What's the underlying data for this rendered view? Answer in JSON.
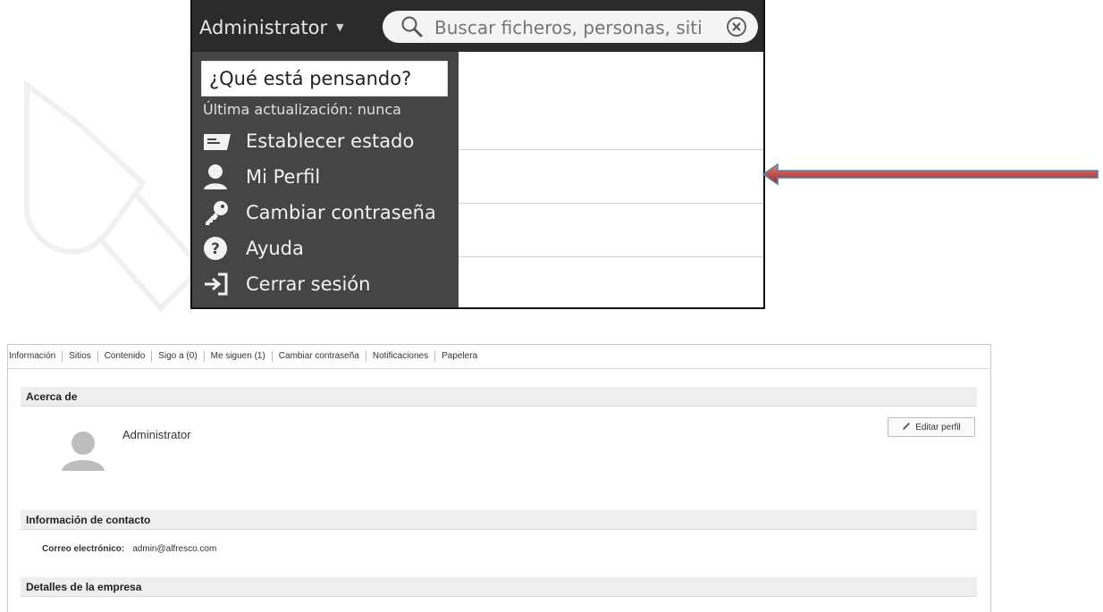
{
  "menu_screenshot": {
    "user_name": "Administrator",
    "search_placeholder": "Buscar ficheros, personas, siti",
    "status_input_value": "¿Qué está pensando?",
    "last_update": "Última actualización: nunca",
    "items": [
      {
        "label": "Establecer estado",
        "icon": "status-card-icon"
      },
      {
        "label": "Mi Perfil",
        "icon": "user-icon"
      },
      {
        "label": "Cambiar contraseña",
        "icon": "key-icon"
      },
      {
        "label": "Ayuda",
        "icon": "help-icon"
      },
      {
        "label": "Cerrar sesión",
        "icon": "logout-icon"
      }
    ]
  },
  "annotation": {
    "arrow_color": "#c0504d",
    "arrow_direction": "left"
  },
  "profile_screenshot": {
    "tabs": [
      "Información",
      "Sitios",
      "Contenido",
      "Sigo a (0)",
      "Me siguen (1)",
      "Cambiar contraseña",
      "Notificaciones",
      "Papelera"
    ],
    "sections": {
      "about": "Acerca de",
      "contact": "Información de contacto",
      "company": "Detalles de la empresa"
    },
    "name": "Administrator",
    "edit_button": "Editar perfil",
    "email_label": "Correo electrónico:",
    "email_value": "admin@alfresco.com"
  }
}
